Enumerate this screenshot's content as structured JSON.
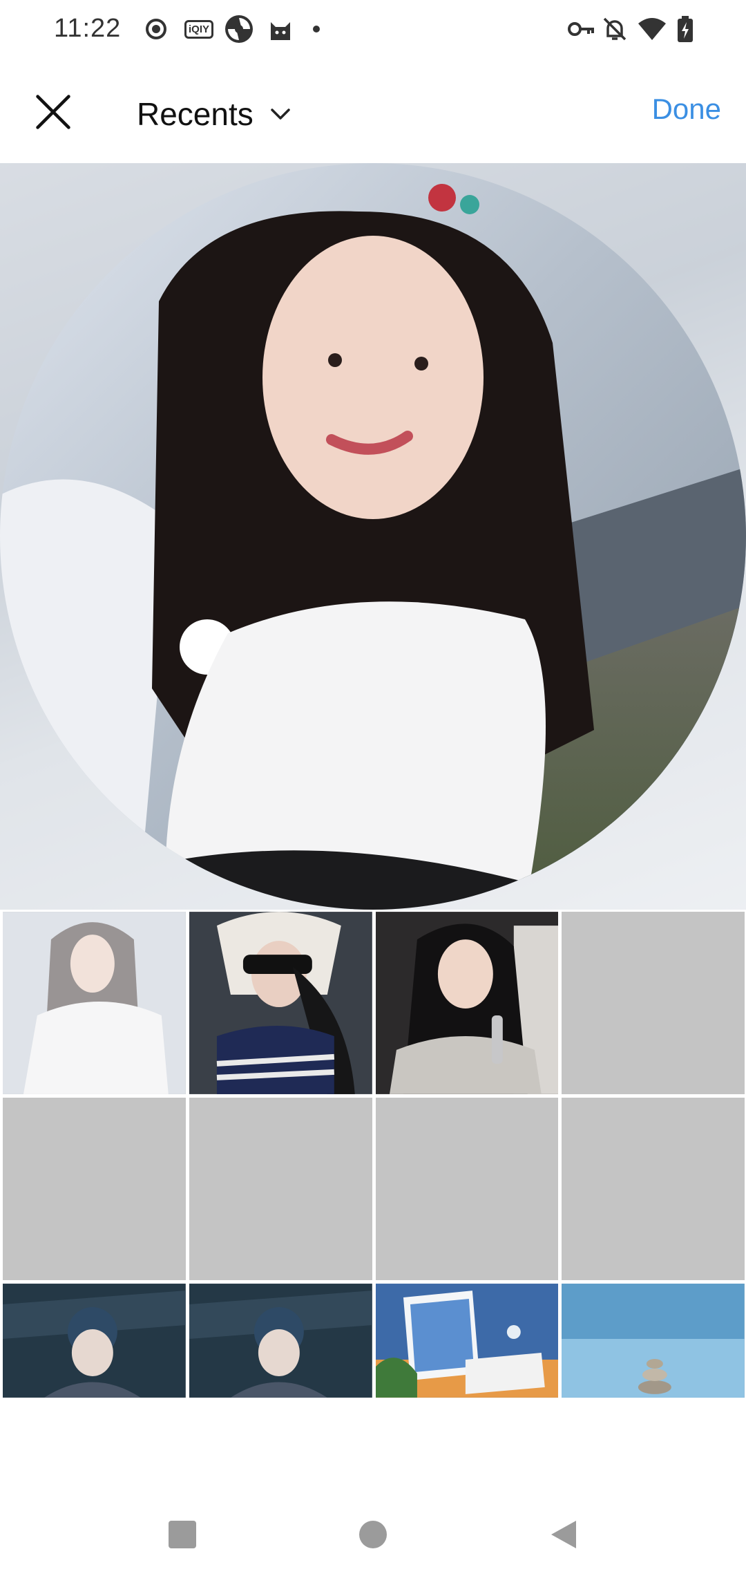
{
  "status_bar": {
    "time": "11:22",
    "qiyi_label": "iQIY",
    "left_icons": [
      "record-icon",
      "iqiyi-icon",
      "aperture-icon",
      "cat-icon",
      "dot-icon"
    ],
    "right_icons": [
      "key-icon",
      "bell-off-icon",
      "wifi-icon",
      "battery-charging-icon"
    ]
  },
  "header": {
    "close_icon": "close-icon",
    "album_title": "Recents",
    "chevron_icon": "chevron-down-icon",
    "done_label": "Done",
    "done_color": "#3b8fe3"
  },
  "preview": {
    "crop_shape": "circle"
  },
  "grid": {
    "rows": [
      [
        "photo",
        "photo",
        "photo",
        "placeholder"
      ],
      [
        "placeholder",
        "placeholder",
        "placeholder",
        "placeholder"
      ],
      [
        "photo",
        "photo",
        "photo",
        "photo"
      ]
    ],
    "placeholder_color": "#c4c4c4"
  },
  "nav_bar": {
    "icons": [
      "recents-square-icon",
      "home-circle-icon",
      "back-triangle-icon"
    ]
  }
}
